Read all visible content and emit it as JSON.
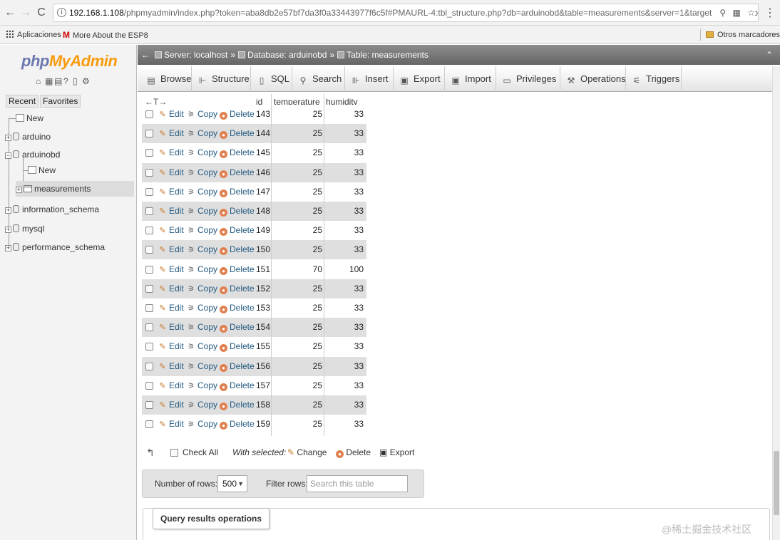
{
  "browser": {
    "url_host": "192.168.1.108",
    "url_rest": "/phpmyadmin/index.php?token=aba8db2e57bf7da3f0a33443977f6c5f#PMAURL-4:tbl_structure.php?db=arduinobd&table=measurements&server=1&target=&token=ab",
    "bookmarks": {
      "apps": "Aplicaciones",
      "esp": "More About the ESP8",
      "other": "Otros marcadores"
    }
  },
  "logo": {
    "php": "php",
    "my": "My",
    "admin": "Admin"
  },
  "nav": {
    "tabs": [
      "Recent",
      "Favorites"
    ],
    "tree": {
      "new_root": "New",
      "arduino": "arduino",
      "arduinobd": "arduinobd",
      "new_db": "New",
      "measurements": "measurements",
      "information_schema": "information_schema",
      "mysql": "mysql",
      "performance_schema": "performance_schema"
    }
  },
  "breadcrumb": {
    "server": "Server: localhost",
    "database": "Database: arduinobd",
    "table": "Table: measurements"
  },
  "tabs": [
    "Browse",
    "Structure",
    "SQL",
    "Search",
    "Insert",
    "Export",
    "Import",
    "Privileges",
    "Operations",
    "Triggers"
  ],
  "table": {
    "columns": [
      "id",
      "temperature",
      "humidity"
    ],
    "action_labels": {
      "edit": "Edit",
      "copy": "Copy",
      "delete": "Delete"
    },
    "rows": [
      {
        "id": "143",
        "temperature": "25",
        "humidity": "33"
      },
      {
        "id": "144",
        "temperature": "25",
        "humidity": "33"
      },
      {
        "id": "145",
        "temperature": "25",
        "humidity": "33"
      },
      {
        "id": "146",
        "temperature": "25",
        "humidity": "33"
      },
      {
        "id": "147",
        "temperature": "25",
        "humidity": "33"
      },
      {
        "id": "148",
        "temperature": "25",
        "humidity": "33"
      },
      {
        "id": "149",
        "temperature": "25",
        "humidity": "33"
      },
      {
        "id": "150",
        "temperature": "25",
        "humidity": "33"
      },
      {
        "id": "151",
        "temperature": "70",
        "humidity": "100"
      },
      {
        "id": "152",
        "temperature": "25",
        "humidity": "33"
      },
      {
        "id": "153",
        "temperature": "25",
        "humidity": "33"
      },
      {
        "id": "154",
        "temperature": "25",
        "humidity": "33"
      },
      {
        "id": "155",
        "temperature": "25",
        "humidity": "33"
      },
      {
        "id": "156",
        "temperature": "25",
        "humidity": "33"
      },
      {
        "id": "157",
        "temperature": "25",
        "humidity": "33"
      },
      {
        "id": "158",
        "temperature": "25",
        "humidity": "33"
      },
      {
        "id": "159",
        "temperature": "25",
        "humidity": "33"
      }
    ]
  },
  "bulk": {
    "check_all": "Check All",
    "with_selected": "With selected:",
    "change": "Change",
    "delete": "Delete",
    "export": "Export"
  },
  "rows_bar": {
    "number_of_rows_label": "Number of rows:",
    "number_of_rows_value": "500",
    "filter_label": "Filter rows:",
    "filter_placeholder": "Search this table"
  },
  "query_ops": {
    "legend": "Query results operations"
  },
  "watermark": "@稀土掘金技术社区"
}
